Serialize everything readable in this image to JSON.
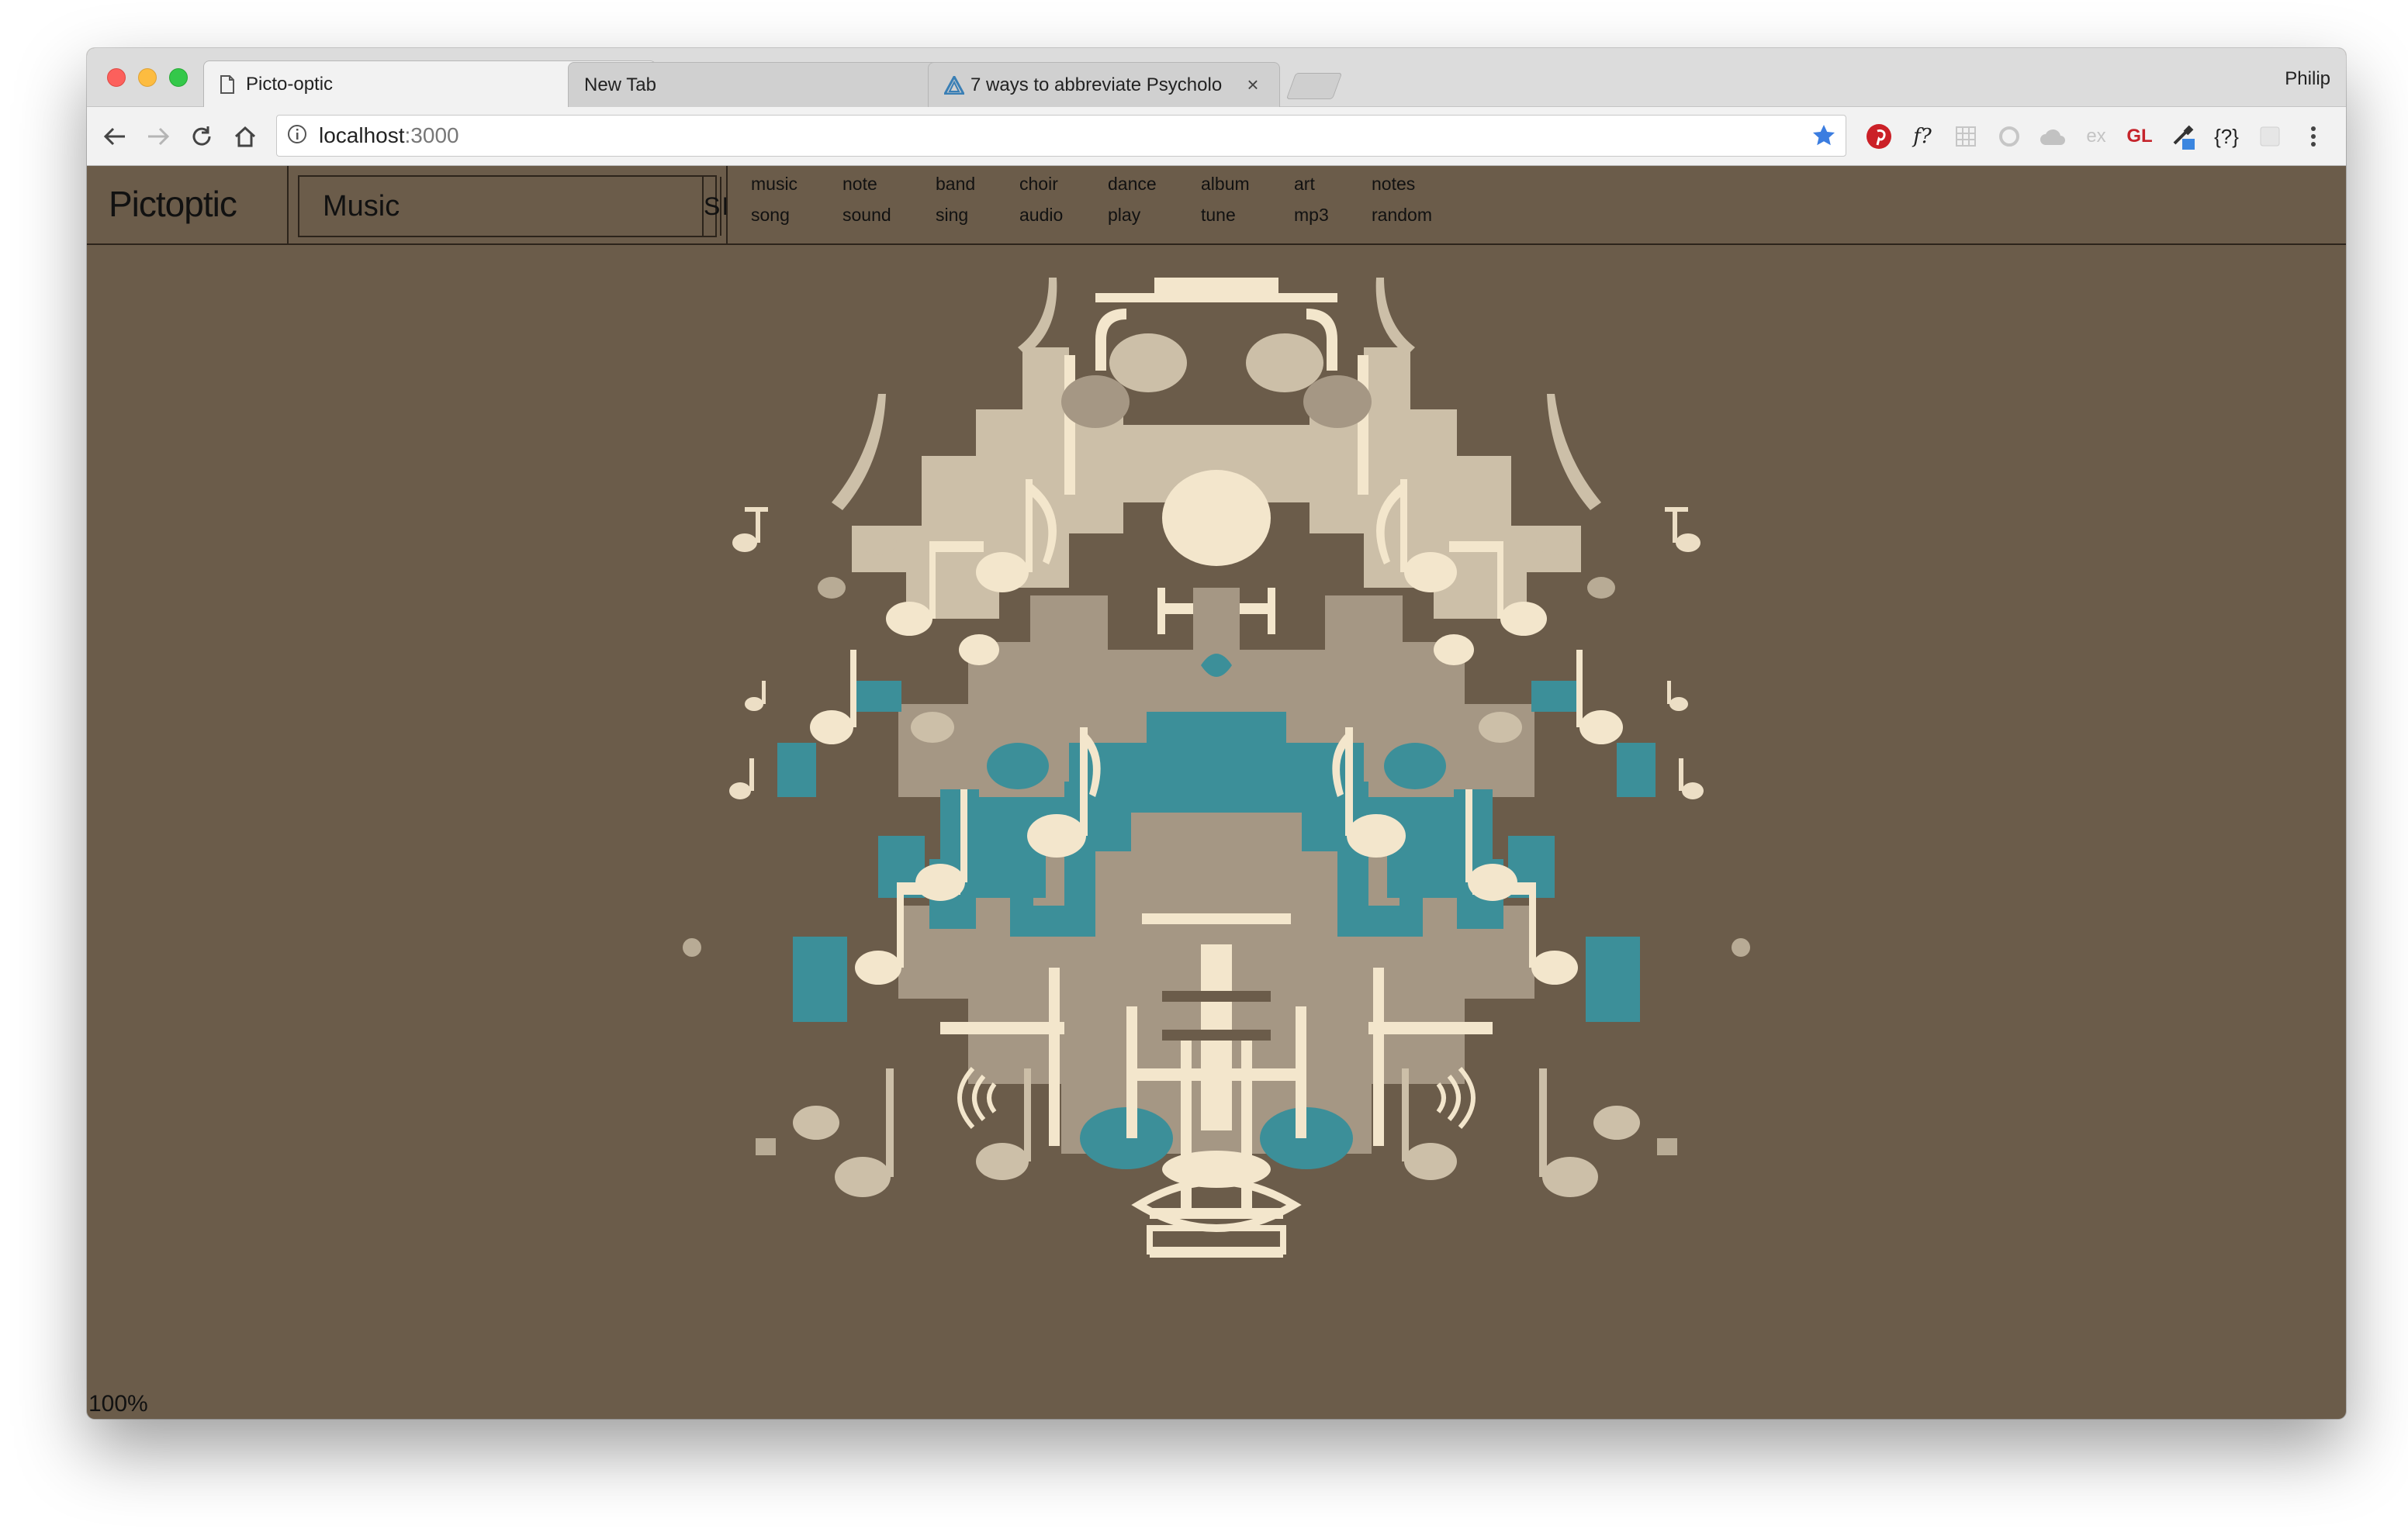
{
  "browser": {
    "tabs": [
      {
        "label": "Picto-optic",
        "active": true
      },
      {
        "label": "New Tab",
        "active": false
      },
      {
        "label": "7 ways to abbreviate Psycholo",
        "active": false
      }
    ],
    "profile_name": "Philip",
    "url_host": "localhost",
    "url_path": ":3000",
    "extensions": [
      "pinterest-icon",
      "f?",
      "grid-icon",
      "refresh-icon",
      "cloud-icon",
      "ex",
      "GL",
      "eyedropper-icon",
      "{?}",
      "blank-icon"
    ]
  },
  "app": {
    "logo": "Pictoptic",
    "search_value": "Music",
    "button_s": "S",
    "button_i": "I",
    "tags_row1": [
      "music",
      "note",
      "band",
      "choir",
      "dance",
      "album",
      "art",
      "notes"
    ],
    "tags_row2": [
      "song",
      "sound",
      "sing",
      "audio",
      "play",
      "tune",
      "mp3",
      "random"
    ],
    "colors": {
      "background": "#6b5c4a",
      "cream": "#f3e6cc",
      "beige": "#ccbfa8",
      "taupe": "#a59784",
      "teal": "#3c8f99"
    }
  },
  "status": {
    "zoom": "100%"
  }
}
